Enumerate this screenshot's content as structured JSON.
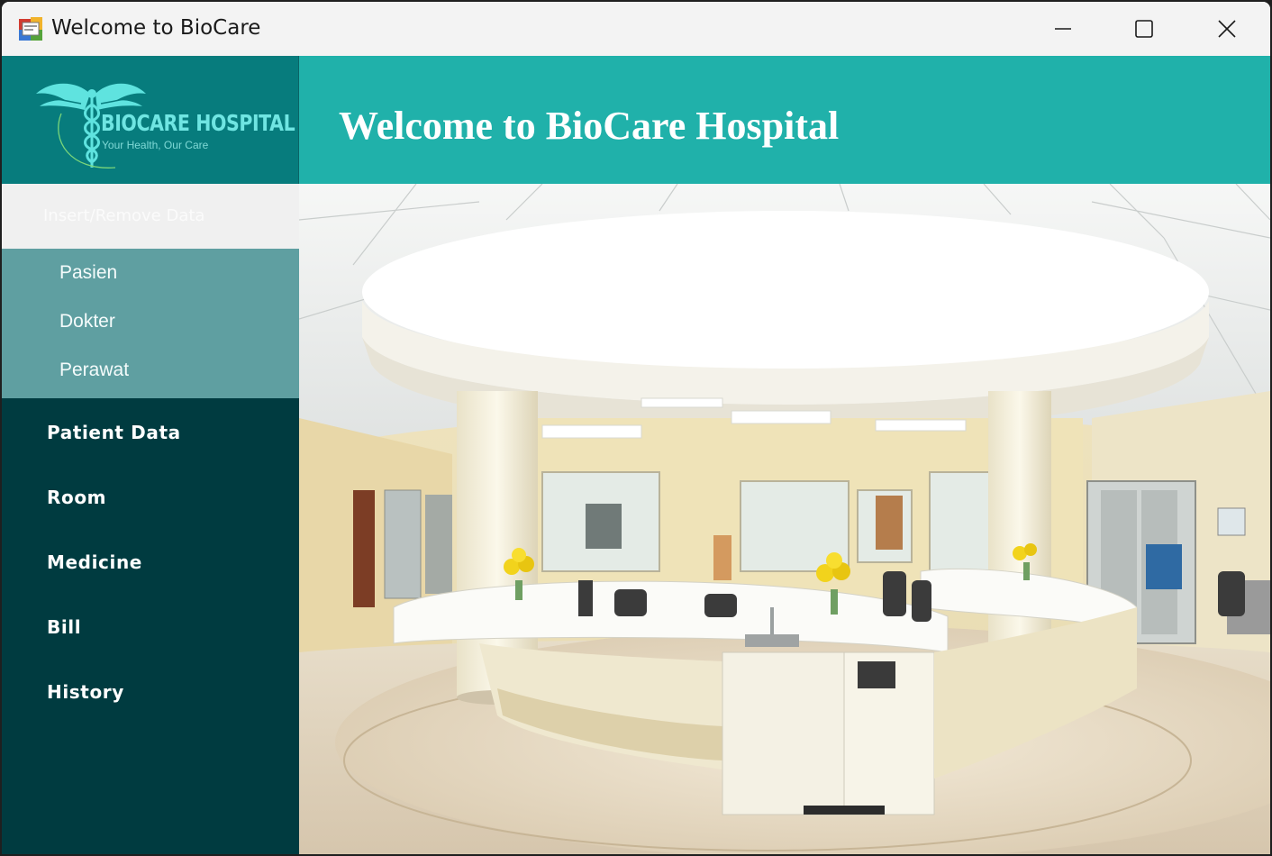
{
  "window": {
    "title": "Welcome to BioCare"
  },
  "logo": {
    "name": "BIOCARE HOSPITAL",
    "tagline": "Your Health, Our Care"
  },
  "header": {
    "title": "Welcome to BioCare Hospital"
  },
  "sidebar": {
    "insert_label": "Insert/Remove Data",
    "submenu": [
      "Pasien",
      "Dokter",
      "Perawat"
    ],
    "items": [
      "Patient Data",
      "Room",
      "Medicine",
      "Bill",
      "History"
    ]
  },
  "colors": {
    "header_teal": "#20b1aa",
    "logo_teal": "#077c7d",
    "sidebar_dark": "#003b40",
    "submenu_teal": "#5f9fa1"
  },
  "icons": {
    "app": "app-icon",
    "logo": "caduceus-icon",
    "minimize": "minimize-icon",
    "maximize": "maximize-icon",
    "close": "close-icon"
  }
}
